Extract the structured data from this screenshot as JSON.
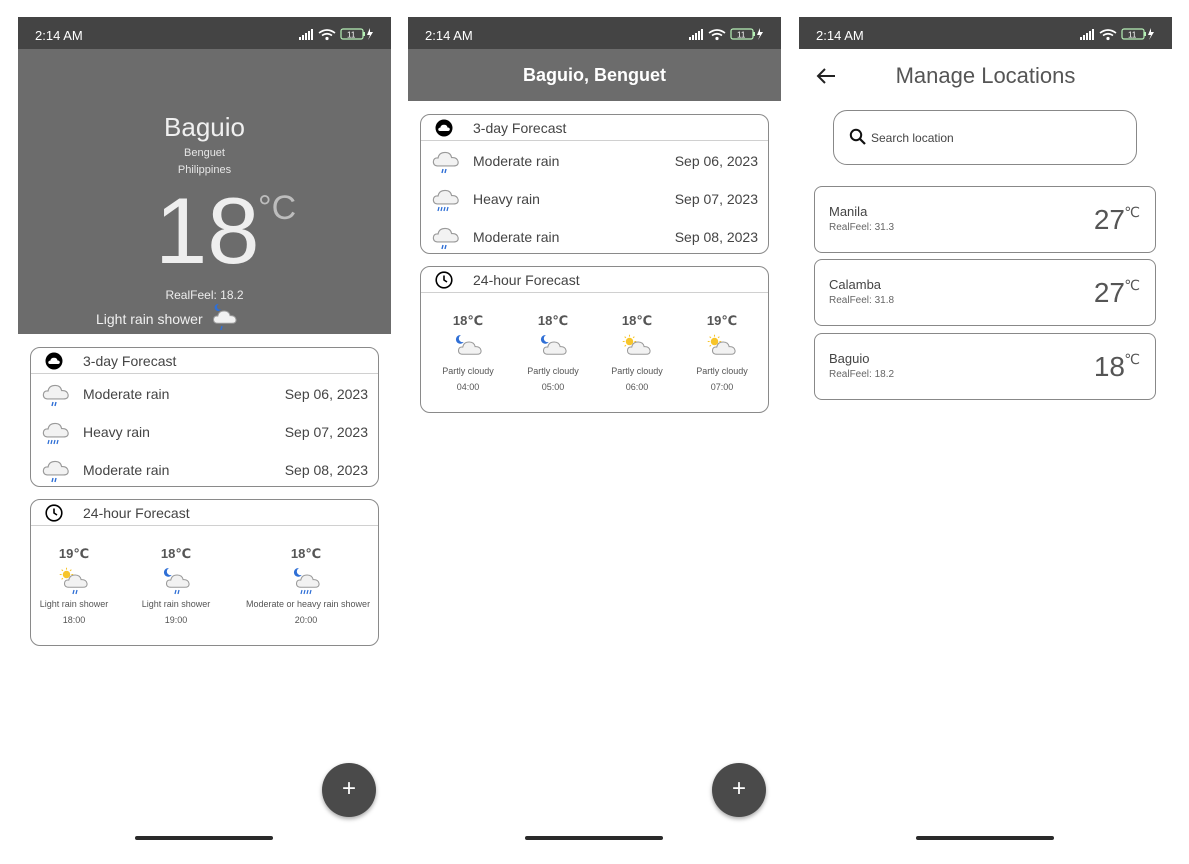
{
  "status": {
    "time": "2:14 AM",
    "battery": "11"
  },
  "screen1": {
    "city": "Baguio",
    "region": "Benguet",
    "country": "Philippines",
    "temp": "18",
    "unit": "°C",
    "realfeel": "RealFeel: 18.2",
    "condition": "Light rain shower",
    "daily_title": "3-day Forecast",
    "daily": [
      {
        "desc": "Moderate rain",
        "date": "Sep 06, 2023",
        "icon": "rain-cloud-icon"
      },
      {
        "desc": "Heavy rain",
        "date": "Sep 07, 2023",
        "icon": "heavy-rain-cloud-icon"
      },
      {
        "desc": "Moderate rain",
        "date": "Sep 08, 2023",
        "icon": "rain-cloud-icon"
      }
    ],
    "hourly_title": "24-hour Forecast",
    "hourly": [
      {
        "temp": "19℃",
        "cond": "Light rain shower",
        "time": "18:00",
        "icon": "sun-rain-cloud-icon"
      },
      {
        "temp": "18℃",
        "cond": "Light rain shower",
        "time": "19:00",
        "icon": "moon-rain-cloud-icon"
      },
      {
        "temp": "18℃",
        "cond": "Moderate or heavy rain shower",
        "time": "20:00",
        "icon": "moon-heavy-rain-cloud-icon"
      }
    ],
    "fab": "+"
  },
  "screen2": {
    "title": "Baguio, Benguet",
    "daily_title": "3-day Forecast",
    "daily": [
      {
        "desc": "Moderate rain",
        "date": "Sep 06, 2023",
        "icon": "rain-cloud-icon"
      },
      {
        "desc": "Heavy rain",
        "date": "Sep 07, 2023",
        "icon": "heavy-rain-cloud-icon"
      },
      {
        "desc": "Moderate rain",
        "date": "Sep 08, 2023",
        "icon": "rain-cloud-icon"
      }
    ],
    "hourly_title": "24-hour Forecast",
    "hourly": [
      {
        "temp": "18℃",
        "cond": "Partly cloudy",
        "time": "04:00",
        "icon": "moon-cloud-icon"
      },
      {
        "temp": "18℃",
        "cond": "Partly cloudy",
        "time": "05:00",
        "icon": "moon-cloud-icon"
      },
      {
        "temp": "18℃",
        "cond": "Partly cloudy",
        "time": "06:00",
        "icon": "sun-cloud-icon"
      },
      {
        "temp": "19℃",
        "cond": "Partly cloudy",
        "time": "07:00",
        "icon": "sun-cloud-icon"
      }
    ],
    "fab": "+"
  },
  "screen3": {
    "title": "Manage Locations",
    "search_placeholder": "Search location",
    "locations": [
      {
        "name": "Manila",
        "realfeel": "RealFeel: 31.3",
        "temp": "27",
        "unit": "℃"
      },
      {
        "name": "Calamba",
        "realfeel": "RealFeel: 31.8",
        "temp": "27",
        "unit": "℃"
      },
      {
        "name": "Baguio",
        "realfeel": "RealFeel: 18.2",
        "temp": "18",
        "unit": "℃"
      }
    ]
  },
  "colors": {
    "header": "#6c6c6c",
    "statusbar": "#444444",
    "fab": "#4a4a4a",
    "rain": "#2f6fd6",
    "sun": "#f5c518"
  }
}
